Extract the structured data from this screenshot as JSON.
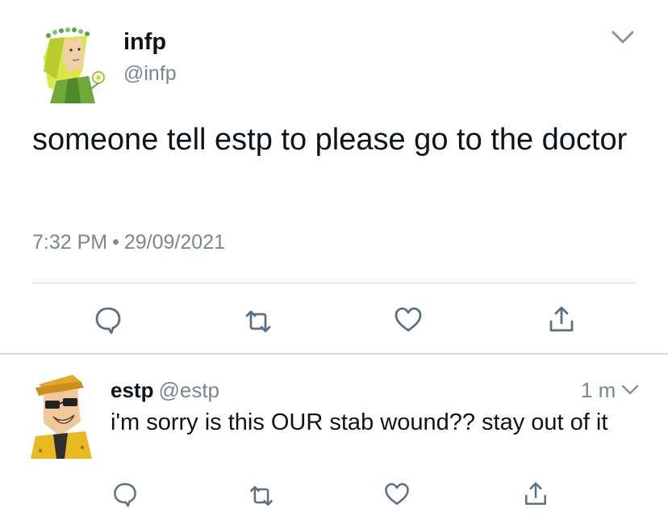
{
  "tweet": {
    "author_name": "infp",
    "author_handle": "@infp",
    "text": "someone tell estp to please go to the doctor",
    "time": "7:32 PM",
    "separator": "•",
    "date": "29/09/2021",
    "actions": [
      "reply-icon",
      "retweet-icon",
      "like-icon",
      "share-icon"
    ],
    "avatar": "infp-avatar"
  },
  "reply": {
    "author_name": "estp",
    "author_handle": "@estp",
    "time_ago": "1 m",
    "text": "i'm sorry is this OUR stab wound?? stay out of it",
    "actions": [
      "reply-icon",
      "retweet-icon",
      "like-icon",
      "share-icon"
    ],
    "avatar": "estp-avatar"
  },
  "colors": {
    "text": "#0f1419",
    "secondary": "#7a8690",
    "icon": "#5b7083",
    "divider": "#d4d9dd",
    "infp_green": "#9bc53d",
    "estp_yellow": "#e8b923"
  }
}
